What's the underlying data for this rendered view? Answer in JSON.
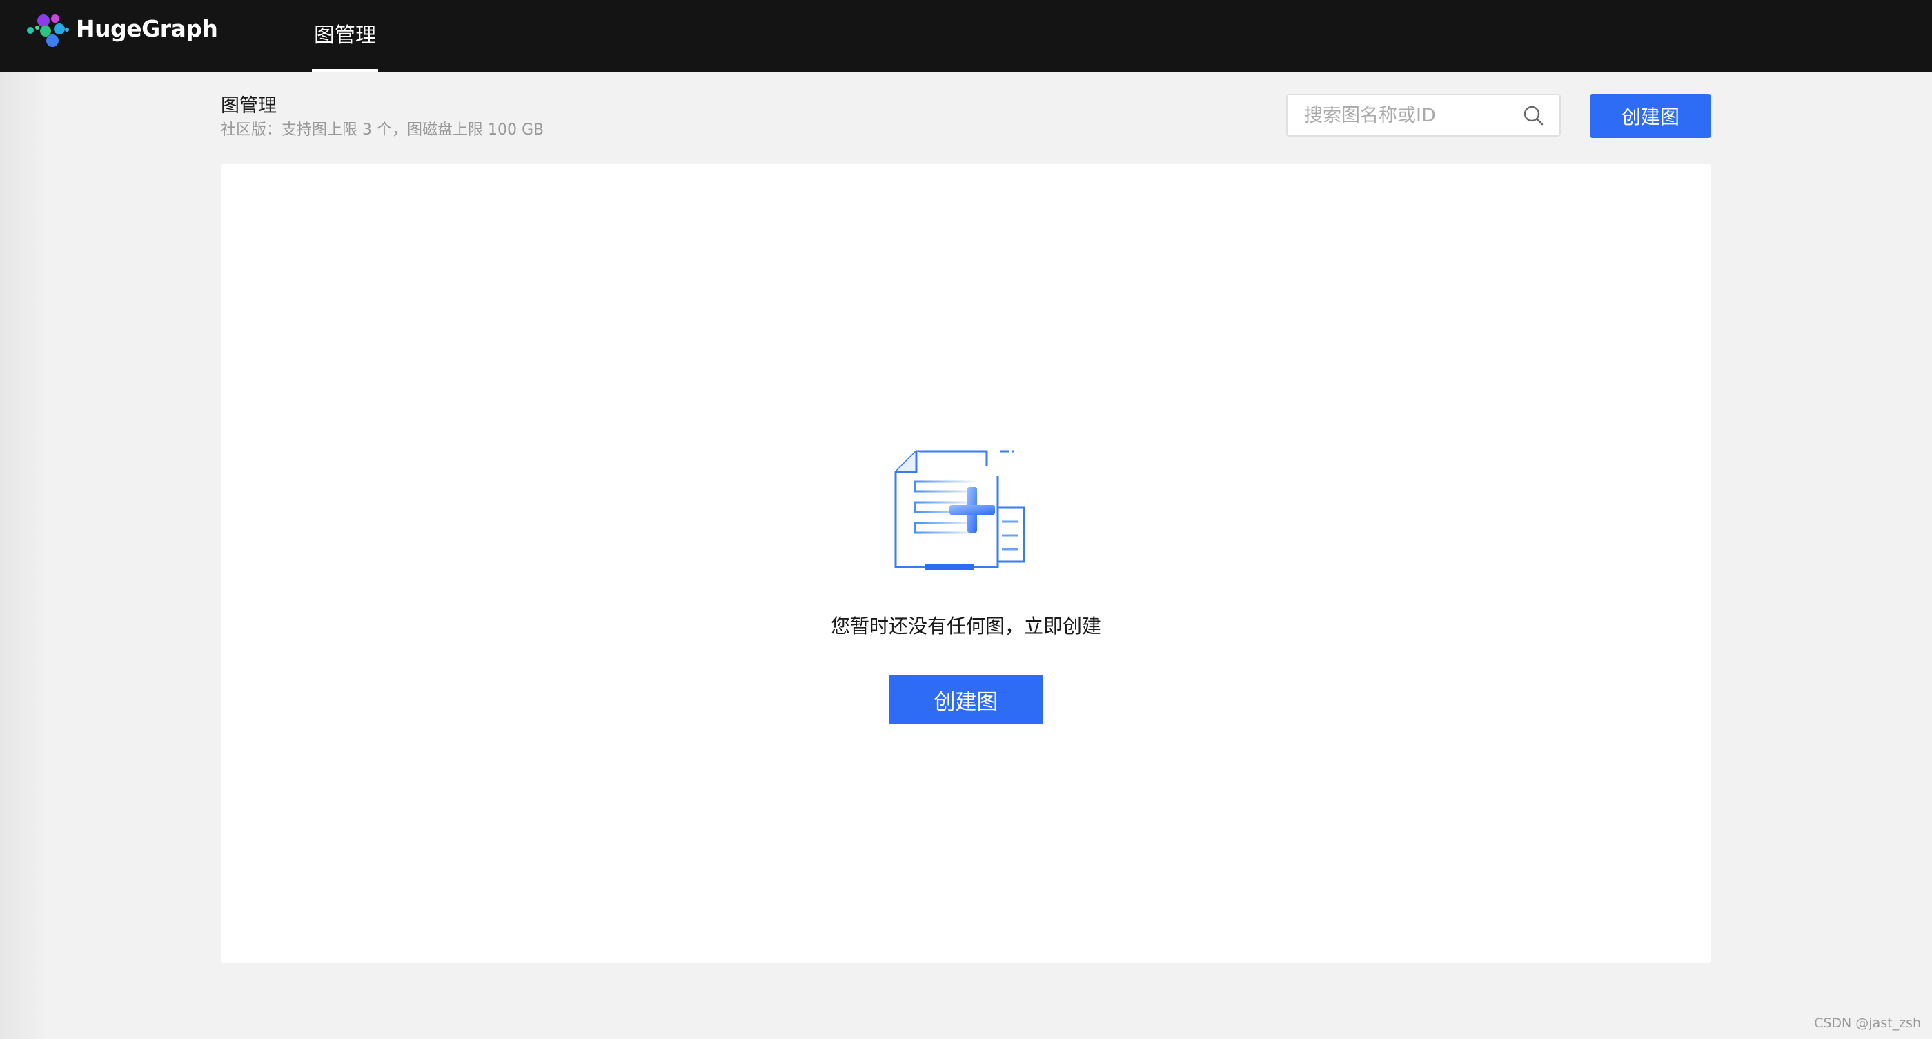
{
  "app": {
    "brand": "HugeGraph",
    "logo_icon": "hugegraph-logo-icon"
  },
  "nav": {
    "tabs": [
      {
        "label": "图管理",
        "active": true
      }
    ]
  },
  "header": {
    "title": "图管理",
    "subtitle": "社区版：支持图上限 3 个，图磁盘上限 100 GB"
  },
  "search": {
    "placeholder": "搜索图名称或ID",
    "value": "",
    "icon": "search-icon"
  },
  "actions": {
    "create_label": "创建图"
  },
  "empty_state": {
    "illustration": "document-add-icon",
    "message": "您暂时还没有任何图，立即创建",
    "button_label": "创建图"
  },
  "watermark": "CSDN @jast_zsh",
  "colors": {
    "topbar": "#141414",
    "primary": "#2e6cf6",
    "background": "#f2f2f2",
    "card": "#ffffff"
  }
}
